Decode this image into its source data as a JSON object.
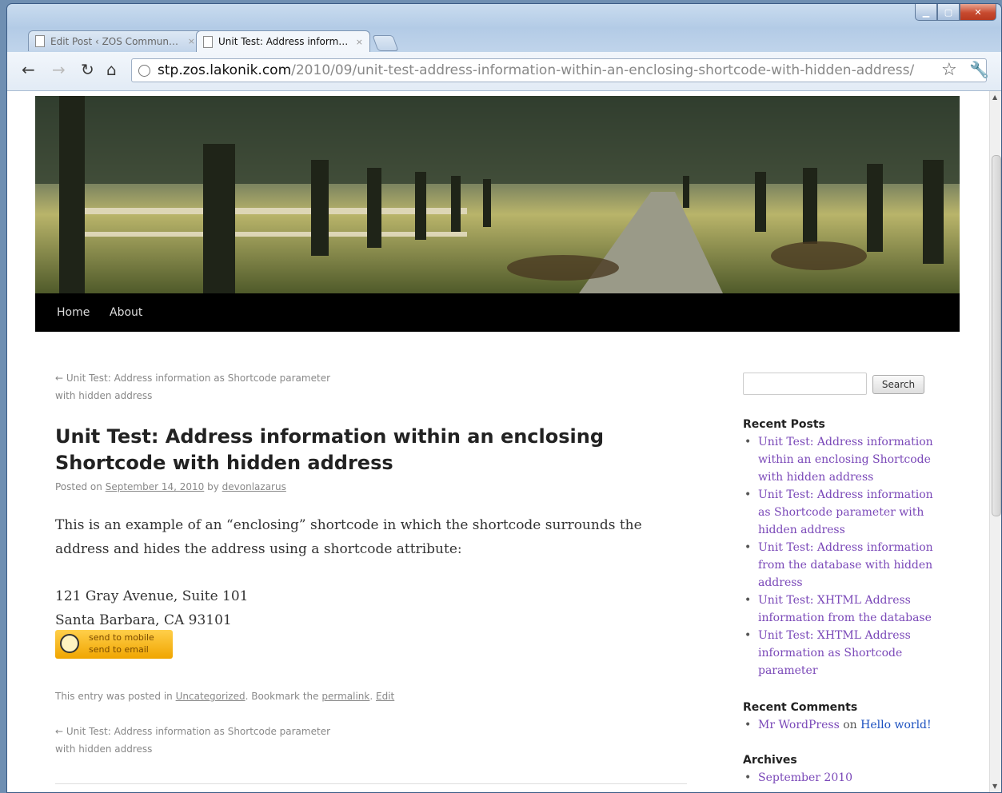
{
  "browser": {
    "tabs": [
      {
        "title": "Edit Post ‹ ZOS Commun…",
        "close": "×"
      },
      {
        "title": "Unit Test: Address inform…",
        "close": "×"
      }
    ],
    "url_host": "stp.zos.lakonik.com",
    "url_path": "/2010/09/unit-test-address-information-within-an-enclosing-shortcode-with-hidden-address/",
    "nav_icons": [
      "back-arrow",
      "forward-arrow",
      "reload",
      "home",
      "star",
      "wrench"
    ]
  },
  "site": {
    "menu": [
      "Home",
      "About"
    ]
  },
  "post": {
    "nav_prev_line1": "← Unit Test: Address information as Shortcode parameter",
    "nav_prev_line2": "with hidden address",
    "title": "Unit Test: Address information within an enclosing Shortcode with hidden address",
    "meta": {
      "posted_on": "Posted on",
      "date": "September 14, 2010",
      "by": "by",
      "author": "devonlazarus"
    },
    "body": "This is an example of an “enclosing” shortcode in which the shortcode surrounds the address and hides the address using a shortcode attribute:",
    "address_line1": "121 Gray Avenue, Suite 101",
    "address_line2": "Santa Barbara, CA 93101",
    "badge_line1": "send to mobile",
    "badge_line2": "send to email",
    "footer": {
      "posted_in": "This entry was posted in",
      "category": "Uncategorized",
      "bookmark": ". Bookmark the",
      "permalink": "permalink",
      "sep": ".",
      "edit": "Edit"
    }
  },
  "sidebar": {
    "search_button": "Search",
    "recent_posts_title": "Recent Posts",
    "recent_posts": [
      "Unit Test: Address information within an enclosing Shortcode with hidden address",
      "Unit Test: Address information as Shortcode parameter with hidden address",
      "Unit Test: Address information from the database with hidden address",
      "Unit Test: XHTML Address information from the database",
      "Unit Test: XHTML Address information as Shortcode parameter"
    ],
    "recent_comments_title": "Recent Comments",
    "comment_author": "Mr WordPress",
    "comment_on": "on",
    "comment_post": "Hello world!",
    "archives_title": "Archives",
    "archives": [
      "September 2010"
    ]
  },
  "colors": {
    "link_visited": "#7a48b8",
    "link": "#1a4fbf",
    "nav_bar": "#000000",
    "badge": "#f0a500"
  }
}
